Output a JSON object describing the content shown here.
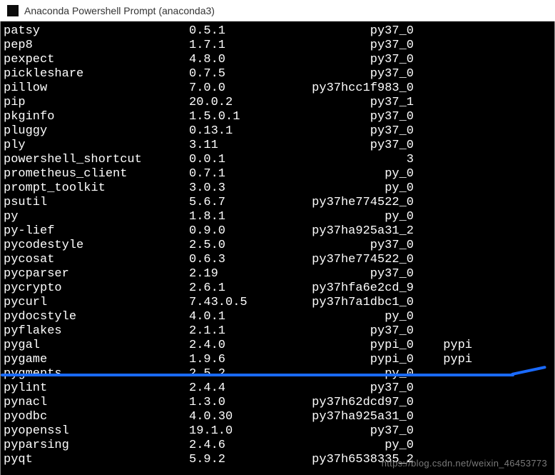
{
  "window": {
    "title": "Anaconda Powershell Prompt (anaconda3)"
  },
  "packages": [
    {
      "name": "patsy",
      "version": "0.5.1",
      "build": "py37_0",
      "channel": ""
    },
    {
      "name": "pep8",
      "version": "1.7.1",
      "build": "py37_0",
      "channel": ""
    },
    {
      "name": "pexpect",
      "version": "4.8.0",
      "build": "py37_0",
      "channel": ""
    },
    {
      "name": "pickleshare",
      "version": "0.7.5",
      "build": "py37_0",
      "channel": ""
    },
    {
      "name": "pillow",
      "version": "7.0.0",
      "build": "py37hcc1f983_0",
      "channel": ""
    },
    {
      "name": "pip",
      "version": "20.0.2",
      "build": "py37_1",
      "channel": ""
    },
    {
      "name": "pkginfo",
      "version": "1.5.0.1",
      "build": "py37_0",
      "channel": ""
    },
    {
      "name": "pluggy",
      "version": "0.13.1",
      "build": "py37_0",
      "channel": ""
    },
    {
      "name": "ply",
      "version": "3.11",
      "build": "py37_0",
      "channel": ""
    },
    {
      "name": "powershell_shortcut",
      "version": "0.0.1",
      "build": "3",
      "channel": ""
    },
    {
      "name": "prometheus_client",
      "version": "0.7.1",
      "build": "py_0",
      "channel": ""
    },
    {
      "name": "prompt_toolkit",
      "version": "3.0.3",
      "build": "py_0",
      "channel": ""
    },
    {
      "name": "psutil",
      "version": "5.6.7",
      "build": "py37he774522_0",
      "channel": ""
    },
    {
      "name": "py",
      "version": "1.8.1",
      "build": "py_0",
      "channel": ""
    },
    {
      "name": "py-lief",
      "version": "0.9.0",
      "build": "py37ha925a31_2",
      "channel": ""
    },
    {
      "name": "pycodestyle",
      "version": "2.5.0",
      "build": "py37_0",
      "channel": ""
    },
    {
      "name": "pycosat",
      "version": "0.6.3",
      "build": "py37he774522_0",
      "channel": ""
    },
    {
      "name": "pycparser",
      "version": "2.19",
      "build": "py37_0",
      "channel": ""
    },
    {
      "name": "pycrypto",
      "version": "2.6.1",
      "build": "py37hfa6e2cd_9",
      "channel": ""
    },
    {
      "name": "pycurl",
      "version": "7.43.0.5",
      "build": "py37h7a1dbc1_0",
      "channel": ""
    },
    {
      "name": "pydocstyle",
      "version": "4.0.1",
      "build": "py_0",
      "channel": ""
    },
    {
      "name": "pyflakes",
      "version": "2.1.1",
      "build": "py37_0",
      "channel": ""
    },
    {
      "name": "pygal",
      "version": "2.4.0",
      "build": "pypi_0",
      "channel": "pypi"
    },
    {
      "name": "pygame",
      "version": "1.9.6",
      "build": "pypi_0",
      "channel": "pypi"
    },
    {
      "name": "pygments",
      "version": "2.5.2",
      "build": "py_0",
      "channel": ""
    },
    {
      "name": "pylint",
      "version": "2.4.4",
      "build": "py37_0",
      "channel": ""
    },
    {
      "name": "pynacl",
      "version": "1.3.0",
      "build": "py37h62dcd97_0",
      "channel": ""
    },
    {
      "name": "pyodbc",
      "version": "4.0.30",
      "build": "py37ha925a31_0",
      "channel": ""
    },
    {
      "name": "pyopenssl",
      "version": "19.1.0",
      "build": "py37_0",
      "channel": ""
    },
    {
      "name": "pyparsing",
      "version": "2.4.6",
      "build": "py_0",
      "channel": ""
    },
    {
      "name": "pyqt",
      "version": "5.9.2",
      "build": "py37h6538335_2",
      "channel": ""
    }
  ],
  "watermark": "https://blog.csdn.net/weixin_46453773"
}
